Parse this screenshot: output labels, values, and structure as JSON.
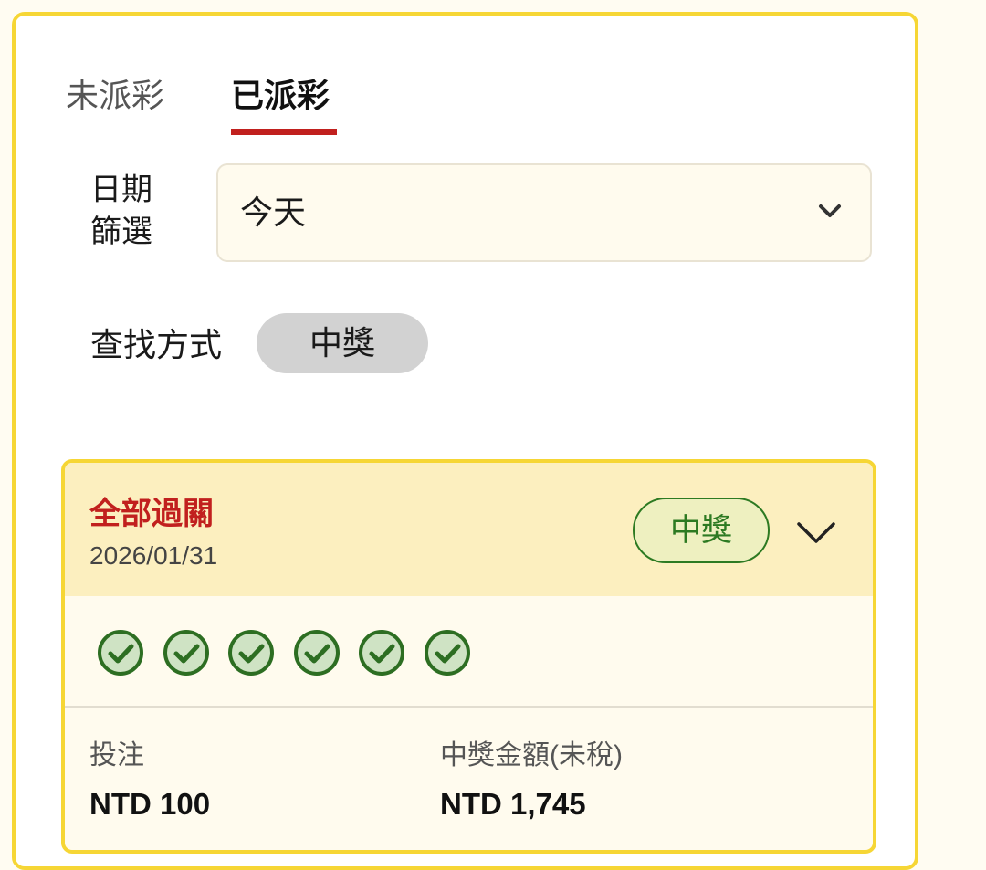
{
  "tabs": [
    {
      "label": "未派彩",
      "active": false
    },
    {
      "label": "已派彩",
      "active": true
    }
  ],
  "date_filter": {
    "label_line1": "日期",
    "label_line2": "篩選",
    "value": "今天"
  },
  "search_method": {
    "label": "查找方式",
    "chip": "中獎"
  },
  "bet_card": {
    "title": "全部過關",
    "date": "2026/01/31",
    "status": "中獎",
    "legs": [
      "won-check-icon",
      "won-check-icon",
      "won-check-icon",
      "won-check-icon",
      "won-check-icon",
      "won-check-icon"
    ],
    "stake_label": "投注",
    "stake_value": "NTD 100",
    "payout_label": "中獎金額(未稅)",
    "payout_value": "NTD 1,745"
  },
  "colors": {
    "accent_red": "#c1201e",
    "border_yellow": "#f6d635",
    "win_green": "#2d7a22",
    "card_header_bg": "#fcefbf"
  }
}
